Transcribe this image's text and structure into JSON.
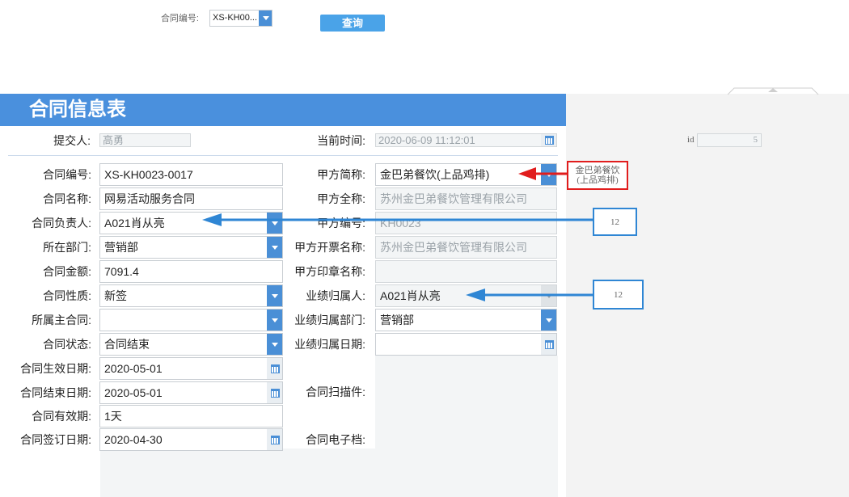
{
  "query": {
    "contract_no_label": "合同编号:",
    "contract_no_value": "XS-KH00...",
    "query_button": "查询"
  },
  "title": "合同信息表",
  "submitter": {
    "label": "提交人:",
    "value": "高勇"
  },
  "current_time": {
    "label": "当前时间:",
    "value": "2020-06-09 11:12:01"
  },
  "id_field": {
    "label": "id",
    "value": "5"
  },
  "left_fields": [
    {
      "label": "合同编号:",
      "value": "XS-KH0023-0017"
    },
    {
      "label": "合同名称:",
      "value": "网易活动服务合同"
    },
    {
      "label": "合同负责人:",
      "value": "A021肖从亮"
    },
    {
      "label": "所在部门:",
      "value": "营销部"
    },
    {
      "label": "合同金额:",
      "value": "7091.4"
    },
    {
      "label": "合同性质:",
      "value": "新签"
    },
    {
      "label": "所属主合同:",
      "value": ""
    },
    {
      "label": "合同状态:",
      "value": "合同结束"
    },
    {
      "label": "合同生效日期:",
      "value": "2020-05-01"
    },
    {
      "label": "合同结束日期:",
      "value": "2020-05-01"
    },
    {
      "label": "合同有效期:",
      "value": "1天"
    },
    {
      "label": "合同签订日期:",
      "value": "2020-04-30"
    }
  ],
  "right_fields": [
    {
      "label": "甲方简称:",
      "value": "金巴弟餐饮(上品鸡排)"
    },
    {
      "label": "甲方全称:",
      "value": "苏州金巴弟餐饮管理有限公司"
    },
    {
      "label": "甲方编号:",
      "value": "KH0023"
    },
    {
      "label": "甲方开票名称:",
      "value": "苏州金巴弟餐饮管理有限公司"
    },
    {
      "label": "甲方印章名称:",
      "value": ""
    },
    {
      "label": "业绩归属人:",
      "value": "A021肖从亮"
    },
    {
      "label": "业绩归属部门:",
      "value": "营销部"
    },
    {
      "label": "业绩归属日期:",
      "value": ""
    },
    {
      "label": "合同扫描件:",
      "value": ""
    },
    {
      "label": "合同电子档:",
      "value": ""
    }
  ],
  "annotations": {
    "red_box_text": "金巴弟餐饮(上品鸡排)",
    "blue_box_1": "12",
    "blue_box_2": "12"
  },
  "colors": {
    "header_blue": "#4a90dd",
    "accent": "#4a8fd6",
    "red": "#e11d1d",
    "arrow_blue": "#2f86d4"
  }
}
